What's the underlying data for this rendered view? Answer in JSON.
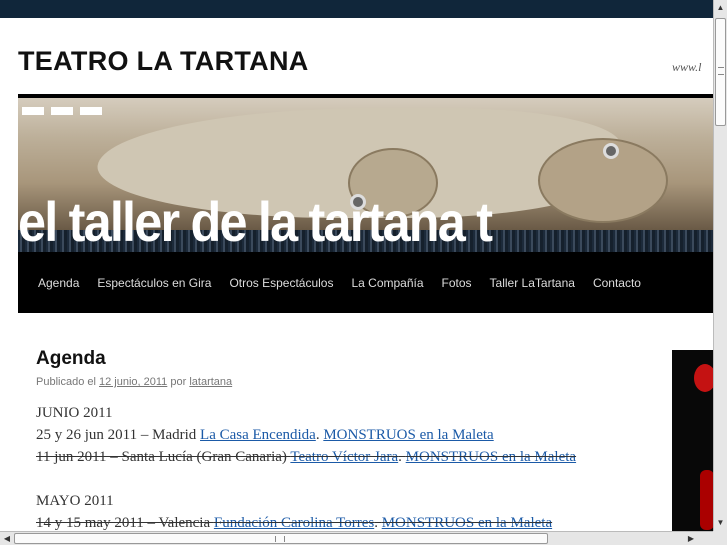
{
  "site": {
    "title": "TEATRO LA TARTANA",
    "description": "www.l"
  },
  "banner": {
    "slogan": "el taller de la tartana t"
  },
  "nav": {
    "items": [
      "Agenda",
      "Espectáculos en Gira",
      "Otros Espectáculos",
      "La Compañía",
      "Fotos",
      "Taller LaTartana",
      "Contacto"
    ]
  },
  "post": {
    "title": "Agenda",
    "meta_prefix": "Publicado el",
    "date": "12 junio, 2011",
    "meta_by": "por",
    "author": "latartana",
    "sections": [
      {
        "month": "JUNIO 2011",
        "entries": [
          {
            "text": "25 y 26 jun 2011 – Madrid ",
            "venue": "La Casa Encendida",
            "sep": ". ",
            "show": "MONSTRUOS en la Maleta",
            "struck": false
          },
          {
            "text": "11 jun 2011 – Santa Lucía (Gran Canaria) ",
            "venue": "Teatro Víctor Jara",
            "sep": ". ",
            "show": "MONSTRUOS en la Maleta",
            "struck": true
          }
        ]
      },
      {
        "month": "MAYO 2011",
        "entries": [
          {
            "text": "14 y 15 may 2011 – Valencia ",
            "venue": "Fundación Carolina Torres",
            "sep": ". ",
            "show": "MONSTRUOS en la Maleta",
            "struck": true
          }
        ]
      }
    ]
  },
  "scrollbars": {
    "up_arrow": "▲",
    "down_arrow": "▼",
    "left_arrow": "◀",
    "right_arrow": "▶"
  }
}
